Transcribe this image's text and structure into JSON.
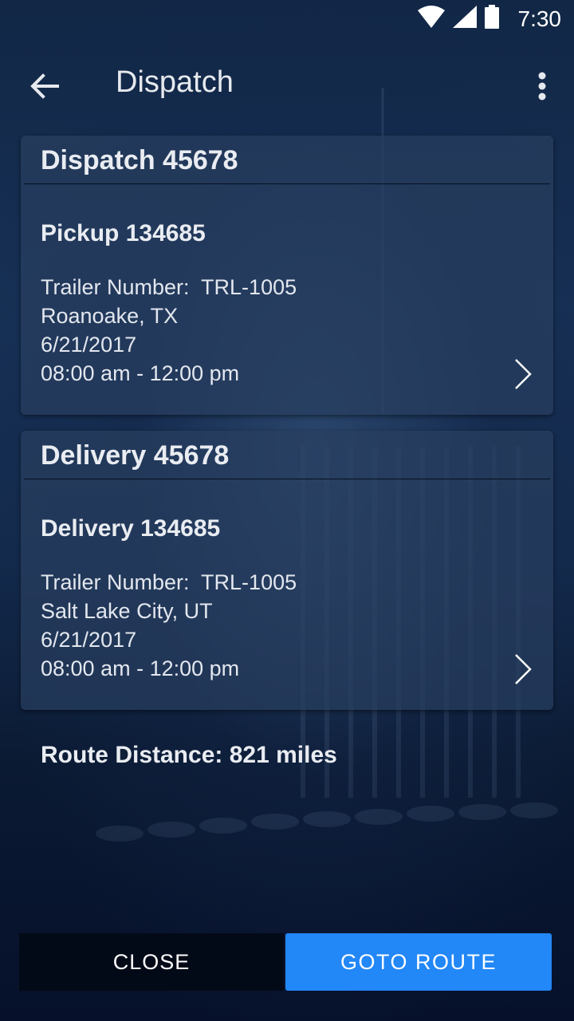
{
  "status_bar": {
    "time": "7:30",
    "icons": [
      "wifi-icon",
      "signal-icon",
      "battery-icon"
    ]
  },
  "app_bar": {
    "title": "Dispatch",
    "back_icon": "arrow-back-icon",
    "menu_icon": "more-vert-icon"
  },
  "cards": [
    {
      "header": "Dispatch 45678",
      "subtitle": "Pickup 134685",
      "trailer": "Trailer Number:  TRL-1005",
      "location": "Roanoake, TX",
      "date": "6/21/2017",
      "time_window": "08:00 am - 12:00 pm"
    },
    {
      "header": "Delivery 45678",
      "subtitle": "Delivery 134685",
      "trailer": "Trailer Number:  TRL-1005",
      "location": "Salt Lake City, UT",
      "date": "6/21/2017",
      "time_window": "08:00 am - 12:00 pm"
    }
  ],
  "route_distance": "Route Distance: 821 miles",
  "buttons": {
    "close": "CLOSE",
    "goto_route": "GOTO ROUTE"
  },
  "colors": {
    "accent": "#2287f7",
    "card": "#283e5f",
    "background": "#0b1a33"
  }
}
